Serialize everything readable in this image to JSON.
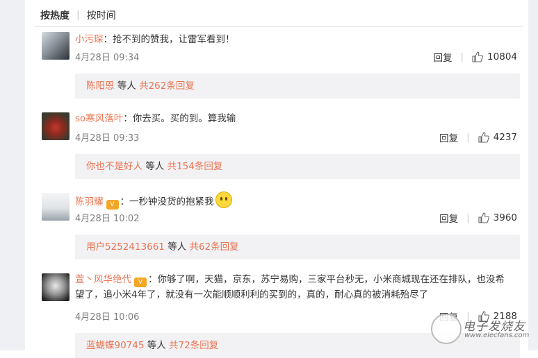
{
  "sort": {
    "hot": "按热度",
    "time": "按时间"
  },
  "comments": [
    {
      "user": "小污琛",
      "text": "：抢不到的赞我，让雷军看到！",
      "time": "4月28日 09:34",
      "reply_label": "回复",
      "likes": "10804",
      "thread": {
        "user": "陈阳恩",
        "mid": " 等人 ",
        "count": "共262条回复"
      }
    },
    {
      "user": "so寒风落叶",
      "text": "：你去买。买的到。算我输",
      "time": "4月28日 09:33",
      "reply_label": "回复",
      "likes": "4237",
      "thread": {
        "user": "你也不是好人",
        "mid": " 等人 ",
        "count": "共154条回复"
      }
    },
    {
      "user": "陈羽耀",
      "text": "：一秒钟没货的抱紧我",
      "time": "4月28日 10:02",
      "reply_label": "回复",
      "likes": "3960",
      "thread": {
        "user": "用户5252413661",
        "mid": " 等人 ",
        "count": "共62条回复"
      }
    },
    {
      "user": "萱丶风华绝代",
      "text": "：你够了啊，天猫，京东，苏宁易购，三家平台秒无，小米商城现在还在排队，也没希望了，追小米4年了，就没有一次能顺顺利利的买到的，真的，耐心真的被消耗殆尽了",
      "time": "4月28日 10:06",
      "reply_label": "回复",
      "likes": "2188",
      "thread": {
        "user": "蓝蝴蝶90745",
        "mid": " 等人 ",
        "count": "共72条回复"
      }
    }
  ],
  "watermark": {
    "name": "电子发烧友",
    "url": "www.elecfans.com"
  },
  "colors": {
    "username": "#eb7350",
    "reply_bg": "#f2f2f5"
  }
}
